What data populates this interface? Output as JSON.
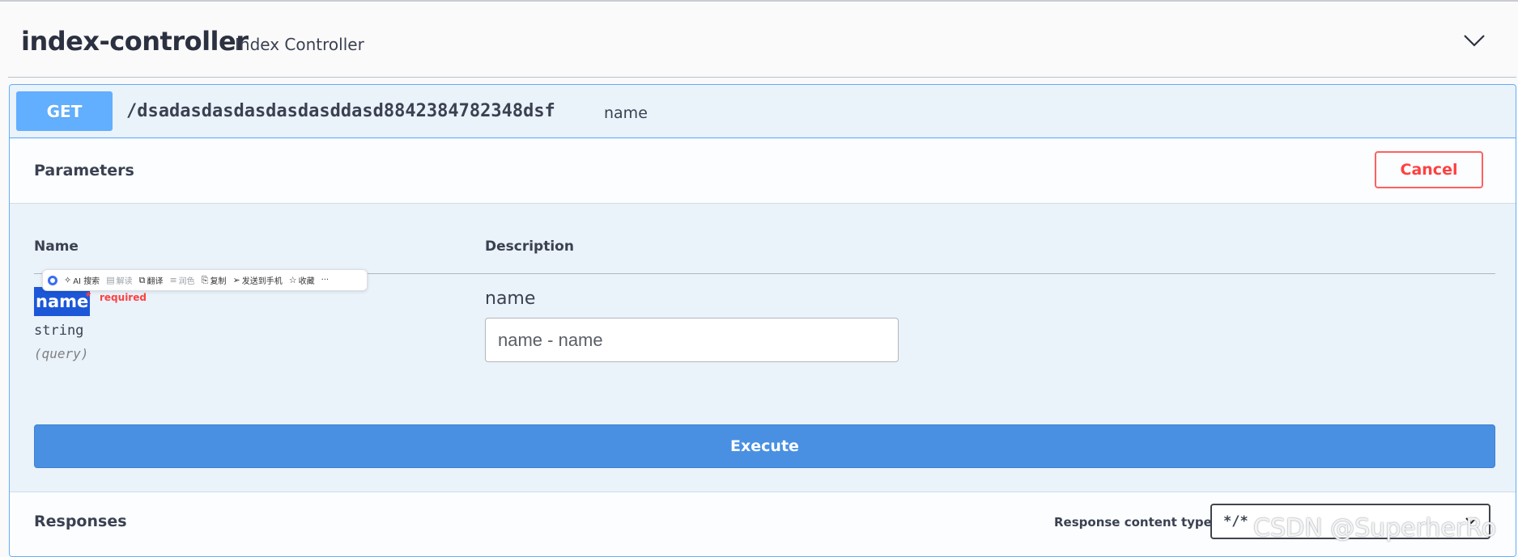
{
  "tag": {
    "name": "index-controller",
    "description": "Index Controller",
    "expand_icon": "chevron-down-icon"
  },
  "operation": {
    "method": "GET",
    "path": "/dsadasdasdasdasdasddasd8842384782348dsf",
    "summary": "name"
  },
  "parameters": {
    "title": "Parameters",
    "cancel_label": "Cancel",
    "col_name": "Name",
    "col_description": "Description",
    "items": [
      {
        "name": "name",
        "required_star": "*",
        "required_label": "required",
        "type": "string",
        "in": "(query)",
        "description": "name",
        "placeholder": "name - name"
      }
    ]
  },
  "selection_toolbar": {
    "items": [
      {
        "icon": "sparkle-icon",
        "label": "AI 搜索"
      },
      {
        "icon": "read-icon",
        "label": "解读"
      },
      {
        "icon": "translate-icon",
        "label": "翻译"
      },
      {
        "icon": "polish-icon",
        "label": "润色"
      },
      {
        "icon": "copy-icon",
        "label": "复制"
      },
      {
        "icon": "send-icon",
        "label": "发送到手机"
      },
      {
        "icon": "star-icon",
        "label": "收藏"
      }
    ],
    "more": "···"
  },
  "execute_label": "Execute",
  "responses": {
    "title": "Responses",
    "content_type_label": "Response content type",
    "content_type_value": "*/*"
  },
  "watermark": "CSDN @SuperherRo",
  "colors": {
    "get_accent": "#61affe",
    "execute": "#4990e2",
    "cancel": "#ff6060",
    "selection": "#1c57d8"
  }
}
